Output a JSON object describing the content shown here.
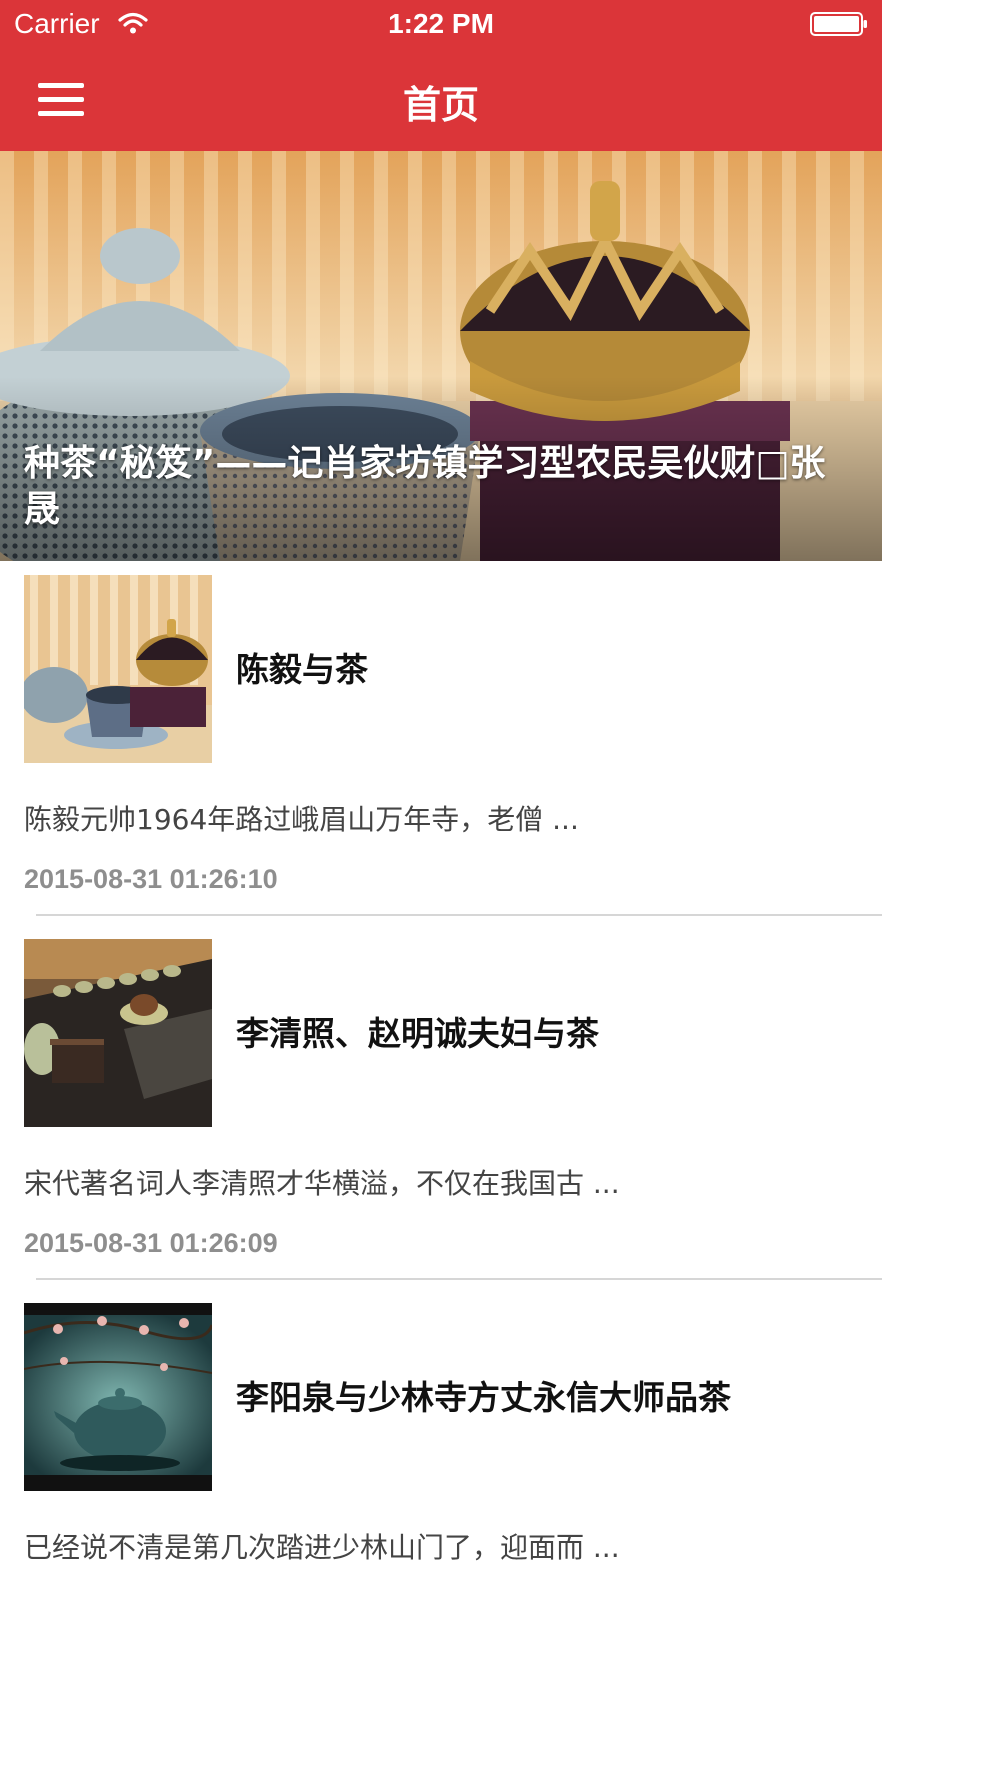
{
  "status_bar": {
    "carrier": "Carrier",
    "time": "1:22 PM",
    "wifi_icon": "wifi-icon",
    "battery_icon": "battery-icon"
  },
  "nav": {
    "title": "首页",
    "menu_icon": "hamburger-menu-icon",
    "color": "#db3539"
  },
  "hero": {
    "caption": "种茶“秘笈”——记肖家坊镇学习型农民吴伙财□张晟"
  },
  "articles": [
    {
      "title": "陈毅与茶",
      "summary": "陈毅元帅1964年路过峨眉山万年寺，老僧 ...",
      "date": "2015-08-31 01:26:10"
    },
    {
      "title": "李清照、赵明诚夫妇与茶",
      "summary": "宋代著名词人李清照才华横溢，不仅在我国古 ...",
      "date": "2015-08-31 01:26:09"
    },
    {
      "title": "李阳泉与少林寺方丈永信大师品茶",
      "summary": "已经说不清是第几次踏进少林山门了，迎面而 ...",
      "date": ""
    }
  ]
}
